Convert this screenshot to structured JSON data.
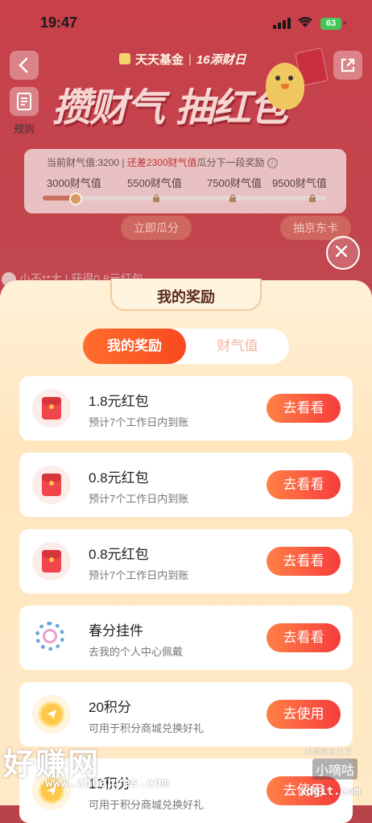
{
  "status_bar": {
    "time": "19:47",
    "battery": "63"
  },
  "header": {
    "brand": "天天基金",
    "brand_sub": "16添财日",
    "hero_title": "攒财气 抽红包"
  },
  "rules": {
    "label": "规则"
  },
  "progress": {
    "current_prefix": "当前财气值:3200 | ",
    "gap_text": "还差2300财气值",
    "suffix": "瓜分下一段奖励",
    "info_icon": "ⓘ",
    "milestones": [
      "3000财气值",
      "5500财气值",
      "7500财气值",
      "9500财气值"
    ],
    "fill_fraction": 0.12
  },
  "actions": {
    "divide": "立即瓜分",
    "jd_card": "抽京东卡"
  },
  "ticker": {
    "text": "小不**大 | 获得0.8元红包"
  },
  "sheet": {
    "title": "我的奖励",
    "tabs": [
      {
        "label": "我的奖励",
        "active": true
      },
      {
        "label": "财气值",
        "active": false
      }
    ],
    "rewards": [
      {
        "icon": "red-envelope-icon",
        "title": "1.8元红包",
        "subtitle": "预计7个工作日内到账",
        "button": "去看看"
      },
      {
        "icon": "red-envelope-icon",
        "title": "0.8元红包",
        "subtitle": "预计7个工作日内到账",
        "button": "去看看"
      },
      {
        "icon": "red-envelope-icon",
        "title": "0.8元红包",
        "subtitle": "预计7个工作日内到账",
        "button": "去看看"
      },
      {
        "icon": "wreath-pendant-icon",
        "title": "春分挂件",
        "subtitle": "去我的个人中心佩戴",
        "button": "去看看"
      },
      {
        "icon": "points-coin-icon",
        "title": "20积分",
        "subtitle": "可用于积分商城兑换好礼",
        "button": "去使用"
      },
      {
        "icon": "points-coin-icon",
        "title": "10积分",
        "subtitle": "可用于积分商城兑换好礼",
        "button": "去使用"
      }
    ]
  },
  "watermark": {
    "site_cn": "好赚网",
    "site_url": "www.zhuanyes.com",
    "right_small": "线报酷友社区",
    "right_badge": "小嘀咕",
    "right_url": "xdgit.com"
  },
  "colors": {
    "accent": "#f84a1e",
    "bg_red": "#c0474f",
    "sheet_bg": "#ffe9c6"
  }
}
